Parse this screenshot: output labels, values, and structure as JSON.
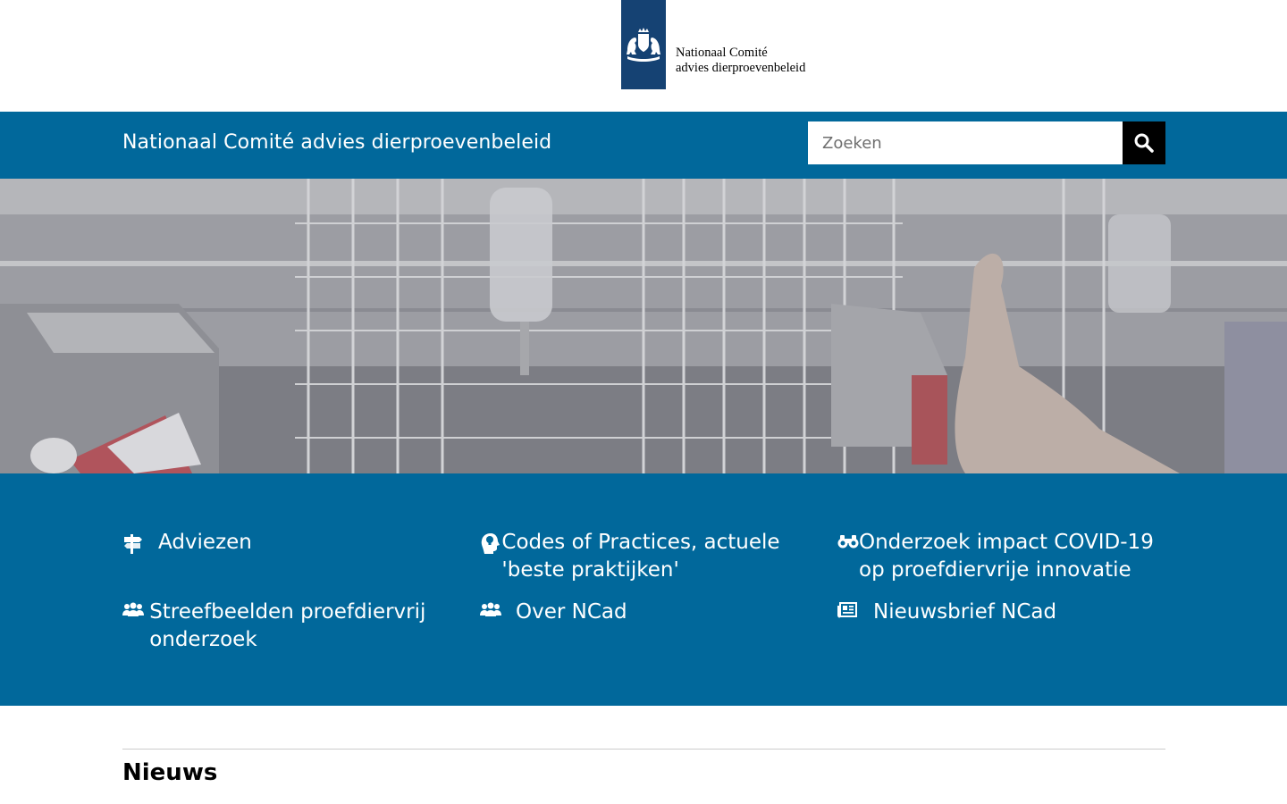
{
  "logo": {
    "line1": "Nationaal Comité",
    "line2": "advies dierproevenbeleid",
    "emblem_icon": "coat-of-arms-icon",
    "emblem_color": "#154273"
  },
  "header": {
    "site_title": "Nationaal Comité advies dierproevenbeleid",
    "search_placeholder": "Zoeken",
    "search_icon": "search-icon",
    "bar_color": "#01689b"
  },
  "hero": {
    "image_description_icon": "hero-photo"
  },
  "links": [
    {
      "label": "Adviezen",
      "icon": "signpost-icon"
    },
    {
      "label": "Codes of Practices, actuele 'beste praktijken'",
      "icon": "head-lightbulb-icon"
    },
    {
      "label": "Onderzoek impact COVID-19 op proefdiervrije innovatie",
      "icon": "binoculars-icon"
    },
    {
      "label": "Streefbeelden proefdiervrij onderzoek",
      "icon": "people-icon"
    },
    {
      "label": "Over NCad",
      "icon": "people-icon"
    },
    {
      "label": "Nieuwsbrief NCad",
      "icon": "newsletter-icon"
    }
  ],
  "news": {
    "heading": "Nieuws"
  }
}
